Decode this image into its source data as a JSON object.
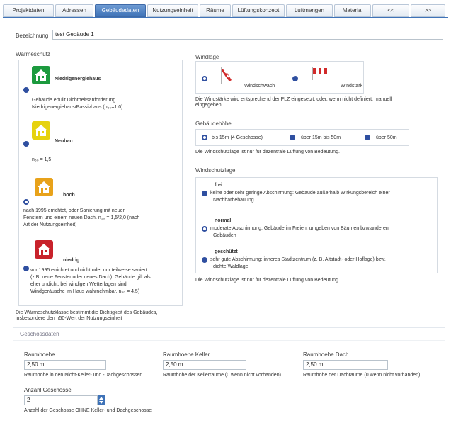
{
  "tabs": [
    "Projektdaten",
    "Adressen",
    "Gebäudedaten",
    "Nutzungseinheit",
    "Räume",
    "Lüftungskonzept",
    "Luftmengen",
    "Material",
    "<<",
    ">>"
  ],
  "active_tab": 2,
  "bezeichnung": {
    "label": "Bezeichnung",
    "value": "test Gebäude 1"
  },
  "waermeschutz": {
    "title": "Wärmeschutz",
    "options": [
      {
        "title": "Niedrigenergiehaus",
        "color": "#1c9a3e",
        "selected": false,
        "desc": [
          "Gebäude erfüllt Dichtheitsanforderung",
          "Niedrigenergiehaus/Passivhaus (n₅₀=1,0)"
        ]
      },
      {
        "title": "Neubau",
        "color": "#e6d20f",
        "selected": false,
        "desc": [
          "n₅₀ = 1,5"
        ]
      },
      {
        "title": "hoch",
        "color": "#e8a21a",
        "selected": true,
        "desc": [
          "nach 1995 errichtet, oder Sanierung mit neuen",
          "Fenstern und einem neuen Dach. n₅₀ = 1,5/2,0 (nach",
          "Art der Nutzungseinheit)"
        ]
      },
      {
        "title": "niedrig",
        "color": "#c8222b",
        "selected": false,
        "desc": [
          "vor 1995 errichtet und nicht oder nur teilweise saniert",
          "(z.B. neue Fenster oder neues Dach). Gebäude gilt als",
          "eher undicht, bei windigen Wetterlagen sind",
          "Windgeräusche im Haus wahrnehmbar. n₅₀ = 4,5)"
        ]
      }
    ],
    "hint": [
      "Die Wärmeschutzklasse bestimmt die Dichtigkeit des Gebäudes,",
      "insbesondere den n50-Wert der Nutzungseinheit"
    ]
  },
  "windlage": {
    "title": "Windlage",
    "options": [
      {
        "label": "Windschwach",
        "selected": true
      },
      {
        "label": "Windstark",
        "selected": false
      }
    ],
    "hint": [
      "Die Windstärke wird entsprechend der PLZ eingesetzt, oder, wenn nicht definiert, manuell",
      "eingegeben."
    ]
  },
  "gebaeudehoehe": {
    "title": "Gebäudehöhe",
    "options": [
      {
        "label": "bis 15m (4 Geschosse)",
        "selected": true
      },
      {
        "label": "über 15m bis 50m",
        "selected": false
      },
      {
        "label": "über 50m",
        "selected": false
      }
    ],
    "hint": "Die Windschutzlage ist nur für dezentrale Lüftung von Bedeutung."
  },
  "windschutzlage": {
    "title": "Windschutzlage",
    "options": [
      {
        "title": "frei",
        "selected": false,
        "desc": [
          "keine oder sehr geringe Abschirmung: Gebäude außerhalb Wirkungsbereich einer",
          "Nachbarbebauung"
        ]
      },
      {
        "title": "normal",
        "selected": true,
        "desc": [
          "moderate Abschirmung: Gebäude im Freien, umgeben von Bäumen bzw.anderen",
          "Gebäuden"
        ]
      },
      {
        "title": "geschützt",
        "selected": false,
        "desc": [
          "sehr gute Abschirmung: inneres Stadtzentrum (z. B. Altstadt- oder Hoflage) bzw.",
          "dichte Waldlage"
        ]
      }
    ],
    "hint": "Die Windschutzlage ist nur für dezentrale Lüftung von Bedeutung."
  },
  "geschossdaten": {
    "title": "Geschossdaten",
    "raumhoehe": {
      "label": "Raumhoehe",
      "value": "2,50 m",
      "hint": "Raumhöhe in den Nicht-Keller- und -Dachgeschossen"
    },
    "raumhoehe_keller": {
      "label": "Raumhoehe Keller",
      "value": "2,50 m",
      "hint": "Raumhöhe der Kellerräume (0 wenn nicht vorhanden)"
    },
    "raumhoehe_dach": {
      "label": "Raumhoehe Dach",
      "value": "2,50 m",
      "hint": "Raumhöhe der Dachräume (0 wenn nicht vorhanden)"
    },
    "anzahl_geschosse": {
      "label": "Anzahl Geschosse",
      "value": "2",
      "hint": "Anzahl der Geschosse OHNE Keller- und Dachgeschosse"
    }
  }
}
